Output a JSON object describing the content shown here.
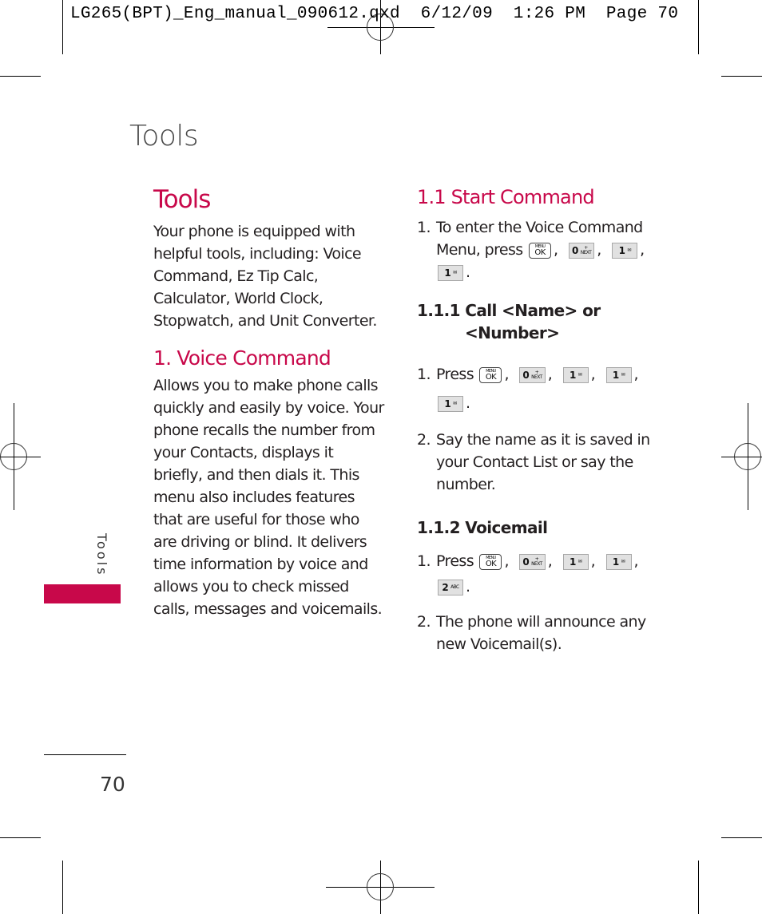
{
  "slug": "LG265(BPT)_Eng_manual_090612.qxd  6/12/09  1:26 PM  Page 70",
  "running_title": "Tools",
  "side_tab": {
    "label": "Tools",
    "color": "#c8084a"
  },
  "page_number": "70",
  "colors": {
    "accent": "#c8084a",
    "text": "#231f20"
  },
  "left_column": {
    "heading": "Tools",
    "intro": "Your phone is equipped with helpful tools, including: Voice Command, Ez Tip Calc, Calculator, World Clock, Stopwatch, and Unit Converter.",
    "section_heading": "1. Voice Command",
    "section_body": "Allows you to make phone calls quickly and easily by voice. Your phone recalls the number from your Contacts, displays it briefly, and then dials it. This menu also includes features that are useful for those who are driving or blind. It delivers time information by voice and allows you to check missed calls, messages and voicemails."
  },
  "right_column": {
    "subheading": "1.1 Start Command",
    "start_steps": [
      {
        "num": "1.",
        "text_before": "To enter the Voice Command Menu, press",
        "keys": [
          "menu-ok",
          "0",
          "1",
          "1"
        ]
      }
    ],
    "call_heading_line1": "1.1.1 Call <Name> or",
    "call_heading_line2": "<Number>",
    "call_steps": [
      {
        "num": "1.",
        "text": "Press",
        "keys": [
          "menu-ok",
          "0",
          "1",
          "1",
          "1"
        ]
      },
      {
        "num": "2.",
        "text": "Say the name as it is saved in your Contact List or say the number."
      }
    ],
    "voicemail_heading": "1.1.2 Voicemail",
    "voicemail_steps": [
      {
        "num": "1.",
        "text": "Press",
        "keys": [
          "menu-ok",
          "0",
          "1",
          "1",
          "2"
        ]
      },
      {
        "num": "2.",
        "text": "The phone will announce any new Voicemail(s)."
      }
    ]
  },
  "keys": {
    "menu_ok": {
      "top": "MENU",
      "main": "OK"
    },
    "zero": {
      "main": "0",
      "sub_top": "+",
      "sub_bottom": "NEXT"
    },
    "one": {
      "main": "1",
      "icon": "✉"
    },
    "two": {
      "main": "2",
      "sub": "ABC"
    }
  },
  "punct": {
    "comma": ",",
    "period": "."
  }
}
